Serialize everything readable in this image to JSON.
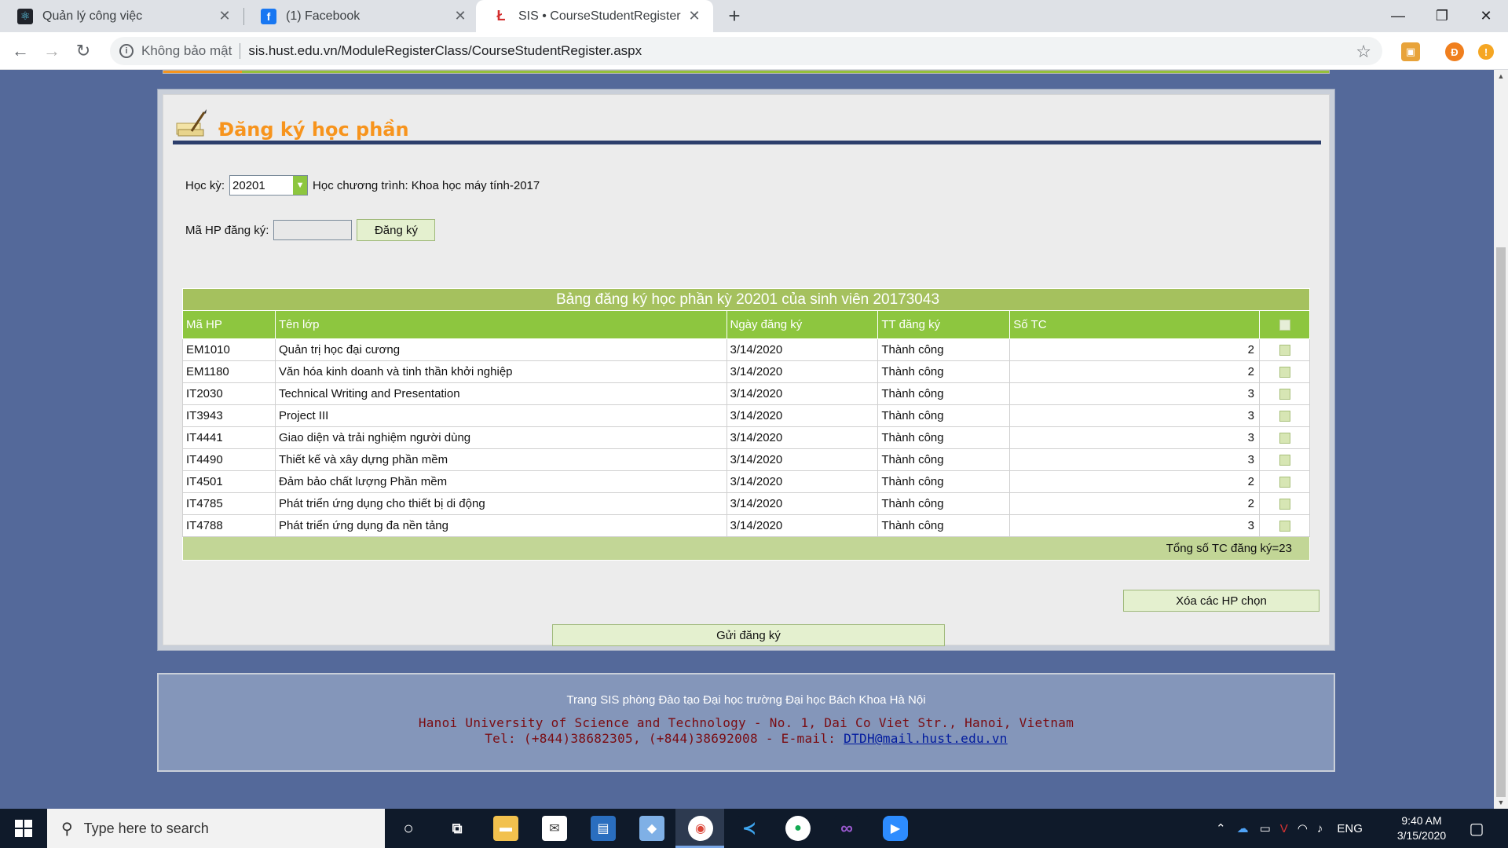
{
  "browser": {
    "tabs": [
      {
        "title": "Quản lý công việc",
        "active": false
      },
      {
        "title": "(1) Facebook",
        "active": false
      },
      {
        "title": "SIS • CourseStudentRegister",
        "active": true
      }
    ],
    "security_text": "Không bảo mật",
    "url": "sis.hust.edu.vn/ModuleRegisterClass/CourseStudentRegister.aspx",
    "profile_initial": "Đ"
  },
  "page": {
    "title": "Đăng ký học phần",
    "semester_label": "Học kỳ:",
    "semester_value": "20201",
    "program_text": "Học chương trình: Khoa học máy tính-2017",
    "course_code_label": "Mã HP đăng ký:",
    "course_code_value": "",
    "register_button": "Đăng ký",
    "table": {
      "caption": "Bảng đăng ký học phần kỳ 20201 của sinh viên 20173043",
      "headers": [
        "Mã HP",
        "Tên lớp",
        "Ngày đăng ký",
        "TT đăng ký",
        "Số TC"
      ],
      "rows": [
        {
          "code": "EM1010",
          "name": "Quản trị học đại cương",
          "date": "3/14/2020",
          "status": "Thành công",
          "credits": "2"
        },
        {
          "code": "EM1180",
          "name": "Văn hóa kinh doanh và tinh thần khởi nghiệp",
          "date": "3/14/2020",
          "status": "Thành công",
          "credits": "2"
        },
        {
          "code": "IT2030",
          "name": "Technical Writing and Presentation",
          "date": "3/14/2020",
          "status": "Thành công",
          "credits": "3"
        },
        {
          "code": "IT3943",
          "name": "Project III",
          "date": "3/14/2020",
          "status": "Thành công",
          "credits": "3"
        },
        {
          "code": "IT4441",
          "name": "Giao diện và trải nghiệm người dùng",
          "date": "3/14/2020",
          "status": "Thành công",
          "credits": "3"
        },
        {
          "code": "IT4490",
          "name": "Thiết kế và xây dựng phần mềm",
          "date": "3/14/2020",
          "status": "Thành công",
          "credits": "3"
        },
        {
          "code": "IT4501",
          "name": "Đảm bảo chất lượng Phần mềm",
          "date": "3/14/2020",
          "status": "Thành công",
          "credits": "2"
        },
        {
          "code": "IT4785",
          "name": "Phát triển ứng dụng cho thiết bị di động",
          "date": "3/14/2020",
          "status": "Thành công",
          "credits": "2"
        },
        {
          "code": "IT4788",
          "name": "Phát triển ứng dụng đa nền tảng",
          "date": "3/14/2020",
          "status": "Thành công",
          "credits": "3"
        }
      ],
      "total_text": "Tổng số TC đăng ký=23"
    },
    "delete_button": "Xóa các HP chọn",
    "submit_button": "Gửi đăng ký"
  },
  "footer": {
    "line1": "Trang SIS phòng Đào tạo Đại học trường Đại học Bách Khoa Hà Nội",
    "line2": "Hanoi University of Science and Technology - No. 1, Dai Co Viet Str., Hanoi, Vietnam",
    "line3_prefix": "Tel: (+844)38682305, (+844)38692008 - E-mail: ",
    "email": "DTDH@mail.hust.edu.vn"
  },
  "taskbar": {
    "search_placeholder": "Type here to search",
    "language": "ENG",
    "time": "9:40 AM",
    "date": "3/15/2020"
  },
  "colors": {
    "page_bg": "#54699a",
    "header_green": "#8dc63f",
    "title_orange": "#f7941d",
    "footer_red": "#7a0c12"
  }
}
